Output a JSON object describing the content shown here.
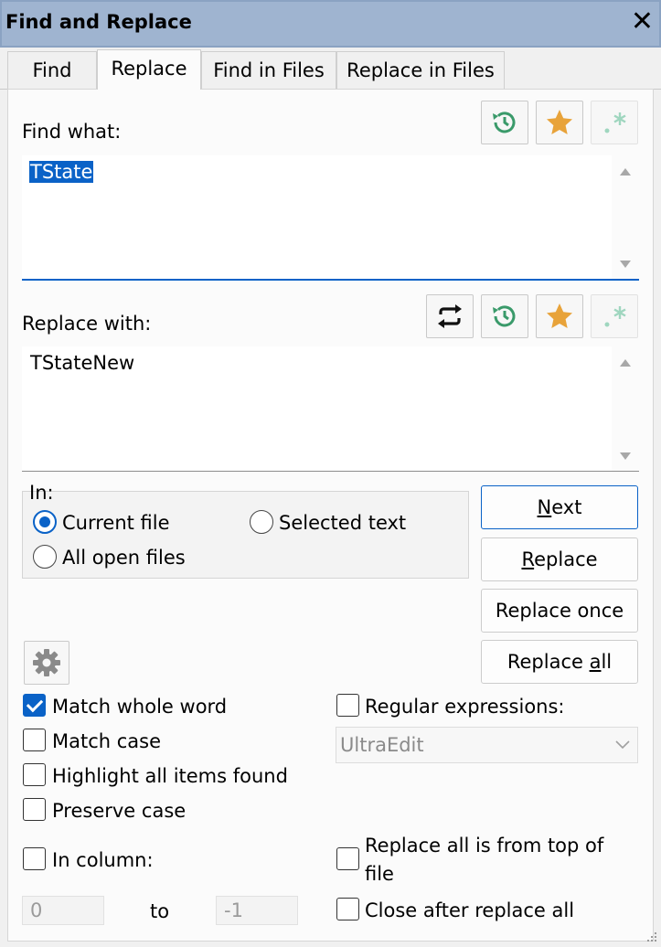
{
  "window": {
    "title": "Find and Replace",
    "close_glyph": "✕"
  },
  "tabs": [
    {
      "label": "Find",
      "active": false
    },
    {
      "label": "Replace",
      "active": true
    },
    {
      "label": "Find in Files",
      "active": false
    },
    {
      "label": "Replace in Files",
      "active": false
    }
  ],
  "find": {
    "label": "Find what:",
    "value": "TState",
    "tool_icons": [
      "history-icon",
      "favorites-star-icon",
      "regex-wildcard-icon"
    ]
  },
  "replace": {
    "label": "Replace with:",
    "value": "TStateNew",
    "tool_icons": [
      "swap-icon",
      "history-icon",
      "favorites-star-icon",
      "regex-wildcard-icon"
    ]
  },
  "scope": {
    "label": "In:",
    "options": [
      {
        "label": "Current file",
        "selected": true
      },
      {
        "label": "Selected text",
        "selected": false
      },
      {
        "label": "All open files",
        "selected": false
      }
    ]
  },
  "buttons": {
    "next": {
      "pre": "",
      "mnemonic": "N",
      "post": "ext"
    },
    "replace": {
      "pre": "",
      "mnemonic": "R",
      "post": "eplace"
    },
    "replace_once": "Replace once",
    "replace_all": {
      "pre": "Replace ",
      "mnemonic": "a",
      "post": "ll"
    }
  },
  "options": {
    "match_whole_word": {
      "label": "Match whole word",
      "checked": true
    },
    "match_case": {
      "label": "Match case",
      "checked": false
    },
    "highlight_all": {
      "label": "Highlight all items found",
      "checked": false
    },
    "preserve_case": {
      "label": "Preserve case",
      "checked": false
    },
    "in_column": {
      "label": "In column:",
      "checked": false
    },
    "regular_expressions": {
      "label": "Regular expressions:",
      "checked": false
    },
    "regex_engine": "UltraEdit",
    "replace_from_top_line1": "Replace all is from top of",
    "replace_from_top_line2": "file",
    "replace_from_top_checked": false,
    "close_after_replace_all": {
      "label": "Close after replace all",
      "checked": false
    }
  },
  "column": {
    "from": "0",
    "to_label": "to",
    "to": "-1"
  },
  "colors": {
    "accent": "#0a62c7",
    "titlebar": "#9fb4d0",
    "history_icon": "#3a9a6a",
    "star_icon": "#e8a33a",
    "regex_icon_disabled": "#9fd6bf"
  }
}
